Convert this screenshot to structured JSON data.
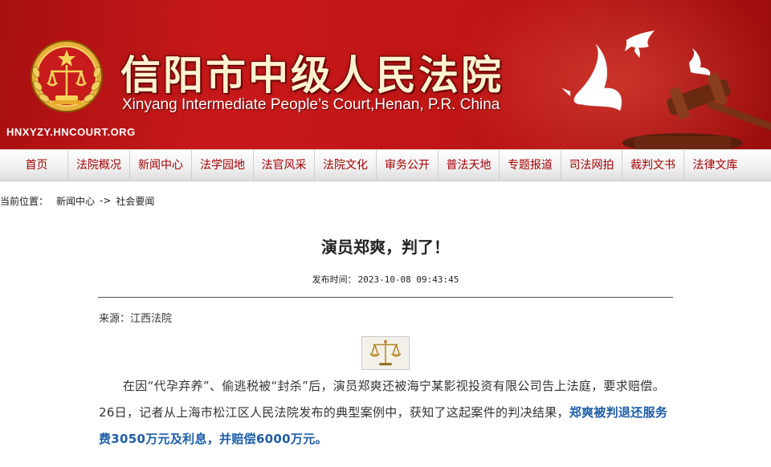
{
  "header": {
    "title": "信阳市中级人民法院",
    "subtitle": "Xinyang Intermediate People’s Court,Henan, P.R. China",
    "url": "HNXYZY.HNCOURT.ORG",
    "emblem_icon": "court-emblem-icon"
  },
  "nav": {
    "items": [
      {
        "label": "首页"
      },
      {
        "label": "法院概况"
      },
      {
        "label": "新闻中心"
      },
      {
        "label": "法学园地"
      },
      {
        "label": "法官风采"
      },
      {
        "label": "法院文化"
      },
      {
        "label": "审务公开"
      },
      {
        "label": "普法天地"
      },
      {
        "label": "专题报道"
      },
      {
        "label": "司法网拍"
      },
      {
        "label": "裁判文书"
      },
      {
        "label": "法律文库"
      }
    ]
  },
  "breadcrumb": {
    "label": "当前位置：",
    "items": [
      "新闻中心",
      "社会要闻"
    ],
    "separator": "->"
  },
  "article": {
    "title": "演员郑爽，判了！",
    "time_label": "发布时间：",
    "time_value": "2023-10-08 09:43:45",
    "source": "来源：江西法院",
    "image_icon": "scales-of-justice-icon",
    "para_text": "在因“代孕弃养”、偷逃税被“封杀”后，演员郑爽还被海宁某影视投资有限公司告上法庭，要求赔偿。26日，记者从上海市松江区人民法院发布的典型案例中，获知了这起案件的判决结果，",
    "para_highlight": "郑爽被判退还服务费3050万元及利息，并赔偿6000万元。"
  },
  "colors": {
    "banner_red": "#c8191a",
    "nav_text": "#a40000",
    "highlight_blue": "#1e5ea8",
    "title_gold": "#fff2d0"
  }
}
